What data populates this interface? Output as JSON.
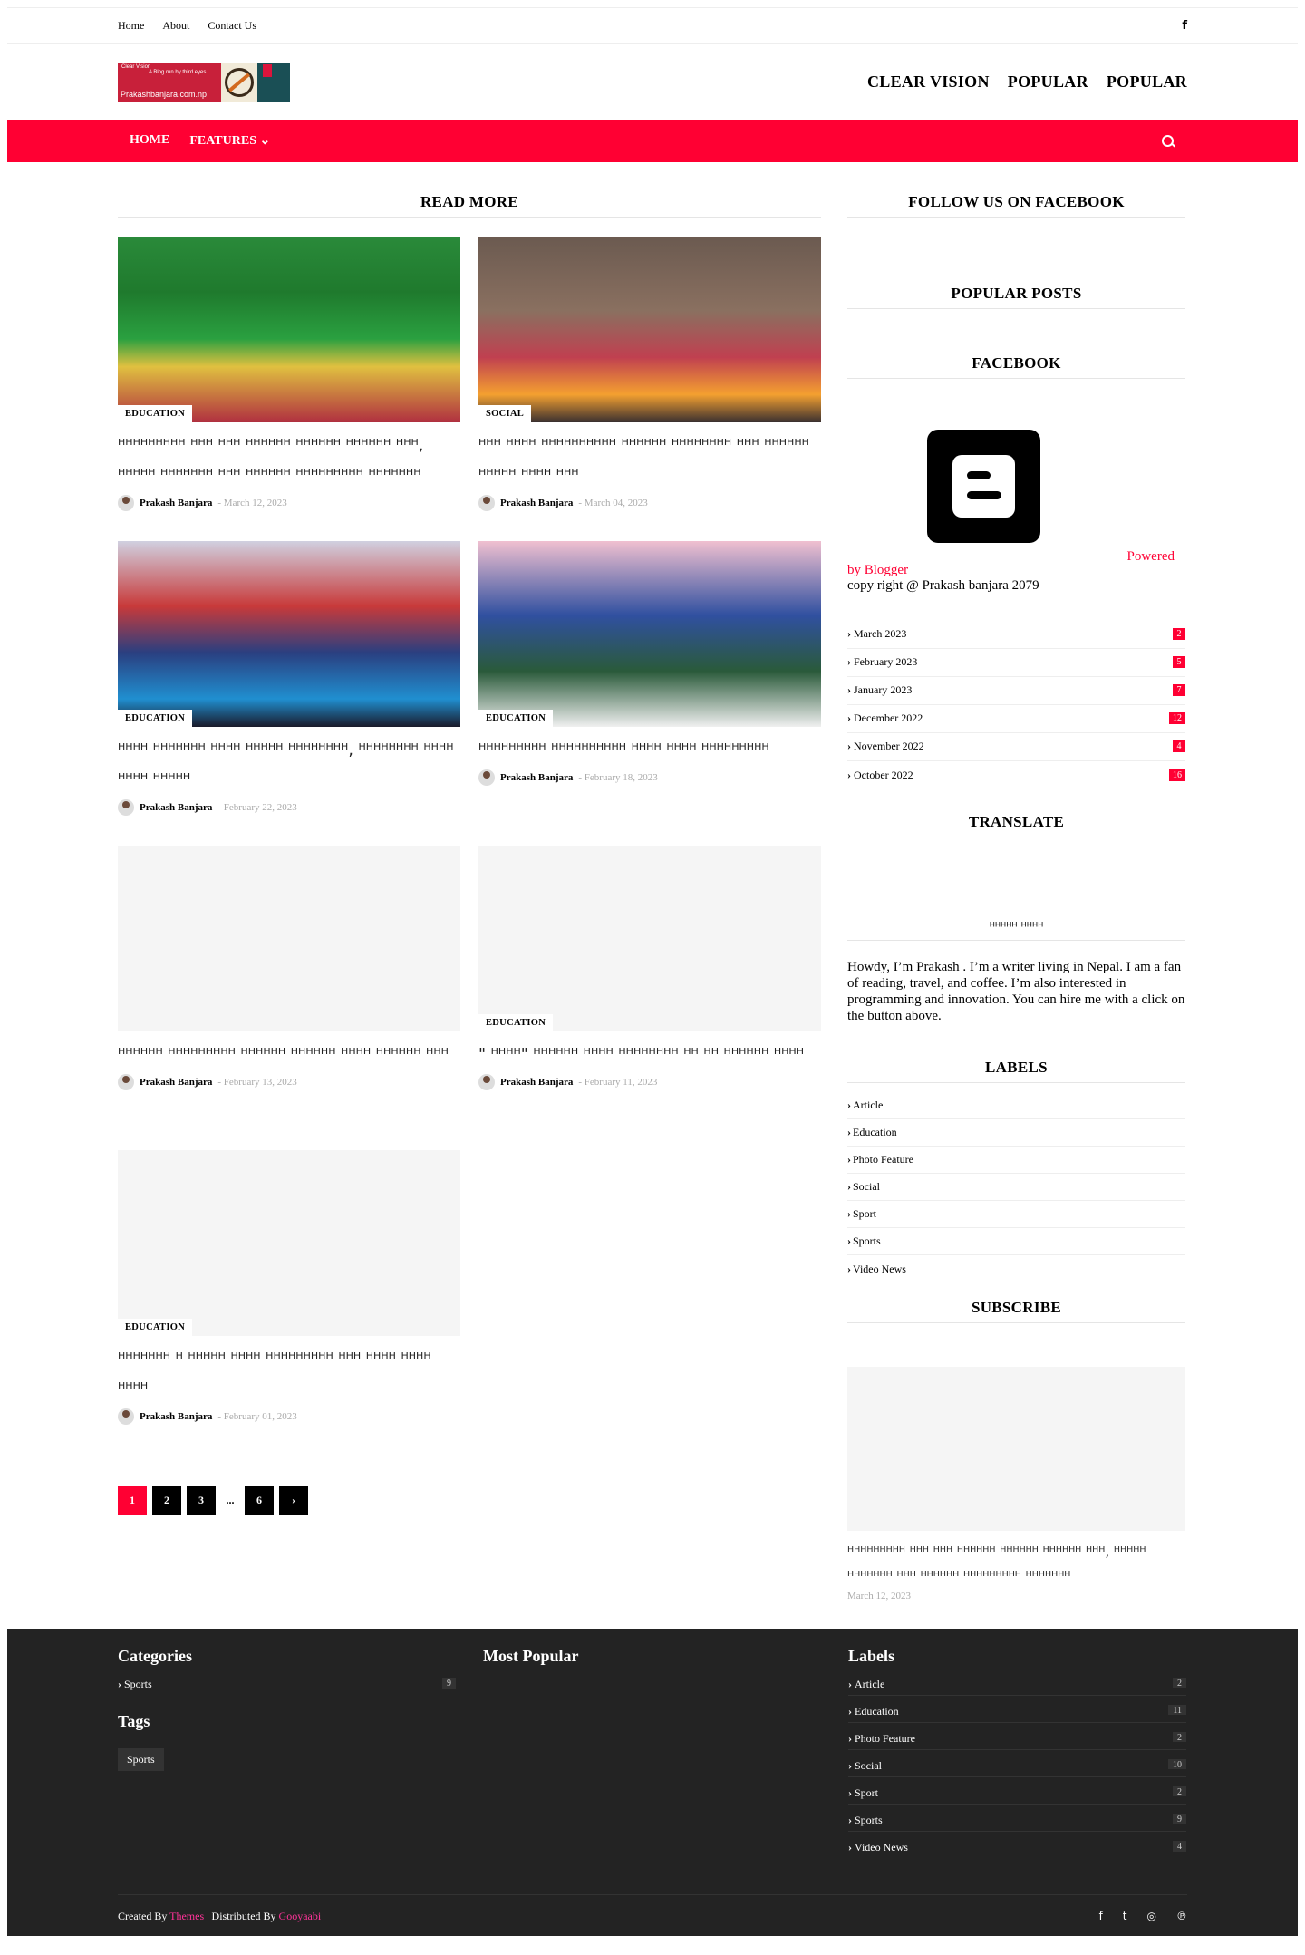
{
  "topbar": {
    "links": [
      "Home",
      "About",
      "Contact Us"
    ],
    "facebook_icon": "facebook-icon",
    "facebook_glyph": "f"
  },
  "header": {
    "logo_alt": "Prakashbanjara.com.np",
    "logo_tagline": "A Blog run by third eyes",
    "logo_title": "Clear Vision",
    "nav": [
      "CLEAR VISION",
      "POPULAR",
      "POPULAR"
    ]
  },
  "redbar": {
    "nav": [
      "HOME",
      "FEATURES ⌄"
    ],
    "search_icon": "search-icon",
    "color": "#ff0033"
  },
  "main": {
    "title": "READ MORE",
    "posts": [
      {
        "tag": "EDUCATION",
        "title": "ᴴᴴᴴᴴᴴᴴᴴᴴᴴ ᴴᴴᴴ ᴴᴴᴴ ᴴᴴᴴᴴᴴᴴ ᴴᴴᴴᴴᴴᴴ ᴴᴴᴴᴴᴴᴴ ᴴᴴᴴ, ᴴᴴᴴᴴᴴ ᴴᴴᴴᴴᴴᴴᴴ ᴴᴴᴴ ᴴᴴᴴᴴᴴᴴ ᴴᴴᴴᴴᴴᴴᴴᴴᴴ ᴴᴴᴴᴴᴴᴴᴴ",
        "author": "Prakash Banjara",
        "date": "- March 12, 2023"
      },
      {
        "tag": "SOCIAL",
        "title": "ᴴᴴᴴ ᴴᴴᴴᴴ ᴴᴴᴴᴴᴴᴴᴴᴴᴴᴴ ᴴᴴᴴᴴᴴᴴ ᴴᴴᴴᴴᴴᴴᴴᴴ ᴴᴴᴴ ᴴᴴᴴᴴᴴᴴ ᴴᴴᴴᴴᴴ ᴴᴴᴴᴴ ᴴᴴᴴ",
        "author": "Prakash Banjara",
        "date": "- March 04, 2023"
      },
      {
        "tag": "EDUCATION",
        "title": "ᴴᴴᴴᴴ ᴴᴴᴴᴴᴴᴴᴴ ᴴᴴᴴᴴ ᴴᴴᴴᴴᴴ ᴴᴴᴴᴴᴴᴴᴴᴴ, ᴴᴴᴴᴴᴴᴴᴴᴴ ᴴᴴᴴᴴ ᴴᴴᴴᴴ ᴴᴴᴴᴴᴴ",
        "author": "Prakash Banjara",
        "date": "- February 22, 2023"
      },
      {
        "tag": "EDUCATION",
        "title": "ᴴᴴᴴᴴᴴᴴᴴᴴᴴ ᴴᴴᴴᴴᴴᴴᴴᴴᴴᴴ ᴴᴴᴴᴴ ᴴᴴᴴᴴ ᴴᴴᴴᴴᴴᴴᴴᴴᴴ",
        "author": "Prakash Banjara",
        "date": "- February 18, 2023"
      },
      {
        "tag": "",
        "title": "ᴴᴴᴴᴴᴴᴴ ᴴᴴᴴᴴᴴᴴᴴᴴᴴ ᴴᴴᴴᴴᴴᴴ ᴴᴴᴴᴴᴴᴴ ᴴᴴᴴᴴ ᴴᴴᴴᴴᴴᴴ ᴴᴴᴴ",
        "author": "Prakash Banjara",
        "date": "- February 13, 2023"
      },
      {
        "tag": "EDUCATION",
        "title": "\" ᴴᴴᴴᴴ\" ᴴᴴᴴᴴᴴᴴ ᴴᴴᴴᴴ ᴴᴴᴴᴴᴴᴴᴴᴴ ᴴᴴ ᴴᴴ ᴴᴴᴴᴴᴴᴴ ᴴᴴᴴᴴ",
        "author": "Prakash Banjara",
        "date": "- February 11, 2023"
      },
      {
        "tag": "EDUCATION",
        "title": "ᴴᴴᴴᴴᴴᴴᴴ ᴴ ᴴᴴᴴᴴᴴ ᴴᴴᴴᴴ ᴴᴴᴴᴴᴴᴴᴴᴴᴴ ᴴᴴᴴ ᴴᴴᴴᴴ ᴴᴴᴴᴴ ᴴᴴᴴᴴ",
        "author": "Prakash Banjara",
        "date": "- February 01, 2023"
      }
    ],
    "pager": [
      "1",
      "2",
      "3",
      "...",
      "6",
      "›"
    ]
  },
  "sidebar": {
    "follow_title": "FOLLOW US ON FACEBOOK",
    "popular_title": "POPULAR POSTS",
    "facebook_title": "FACEBOOK",
    "blogger_icon": "blogger-icon",
    "powered_a": "Powered",
    "powered_b": "by Blogger",
    "copyright": "copy right @ Prakash banjara 2079",
    "archive": [
      {
        "name": "March 2023",
        "count": "2"
      },
      {
        "name": "February 2023",
        "count": "5"
      },
      {
        "name": "January 2023",
        "count": "7"
      },
      {
        "name": "December 2022",
        "count": "12"
      },
      {
        "name": "November 2022",
        "count": "4"
      },
      {
        "name": "October 2022",
        "count": "16"
      }
    ],
    "translate_title": "TRANSLATE",
    "about_title": "ᴴᴴᴴᴴᴴ ᴴᴴᴴᴴ",
    "about_text": "Howdy, I’m Prakash . I’m a writer living in Nepal. I am a fan of reading, travel, and coffee. I’m also interested in programming and innovation. You can hire me with a click on the button above.",
    "labels_title": "LABELS",
    "labels": [
      "Article",
      "Education",
      "Photo Feature",
      "Social",
      "Sport",
      "Sports",
      "Video News"
    ],
    "subscribe_title": "SUBSCRIBE",
    "subscribe_post_title": "ᴴᴴᴴᴴᴴᴴᴴᴴᴴ ᴴᴴᴴ ᴴᴴᴴ ᴴᴴᴴᴴᴴᴴ ᴴᴴᴴᴴᴴᴴ ᴴᴴᴴᴴᴴᴴ ᴴᴴᴴ, ᴴᴴᴴᴴᴴ ᴴᴴᴴᴴᴴᴴᴴ ᴴᴴᴴ ᴴᴴᴴᴴᴴᴴ ᴴᴴᴴᴴᴴᴴᴴᴴᴴ ᴴᴴᴴᴴᴴᴴᴴ",
    "subscribe_post_date": "March 12, 2023"
  },
  "footer": {
    "categories_title": "Categories",
    "categories": [
      {
        "name": "Sports",
        "count": "9"
      }
    ],
    "tags_title": "Tags",
    "tags": [
      "Sports"
    ],
    "popular_title": "Most Popular",
    "labels_title": "Labels",
    "labels": [
      {
        "name": "Article",
        "count": "2"
      },
      {
        "name": "Education",
        "count": "11"
      },
      {
        "name": "Photo Feature",
        "count": "2"
      },
      {
        "name": "Social",
        "count": "10"
      },
      {
        "name": "Sport",
        "count": "2"
      },
      {
        "name": "Sports",
        "count": "9"
      },
      {
        "name": "Video News",
        "count": "4"
      }
    ],
    "created_by": "Created By",
    "themes": "Themes",
    "distributed_by": "| Distributed By",
    "gooyaabi": "Gooyaabi",
    "social_icons": [
      "facebook-icon",
      "twitter-icon",
      "instagram-icon",
      "pinterest-icon"
    ],
    "social_glyphs": [
      "f",
      "t",
      "◎",
      "℗"
    ]
  }
}
